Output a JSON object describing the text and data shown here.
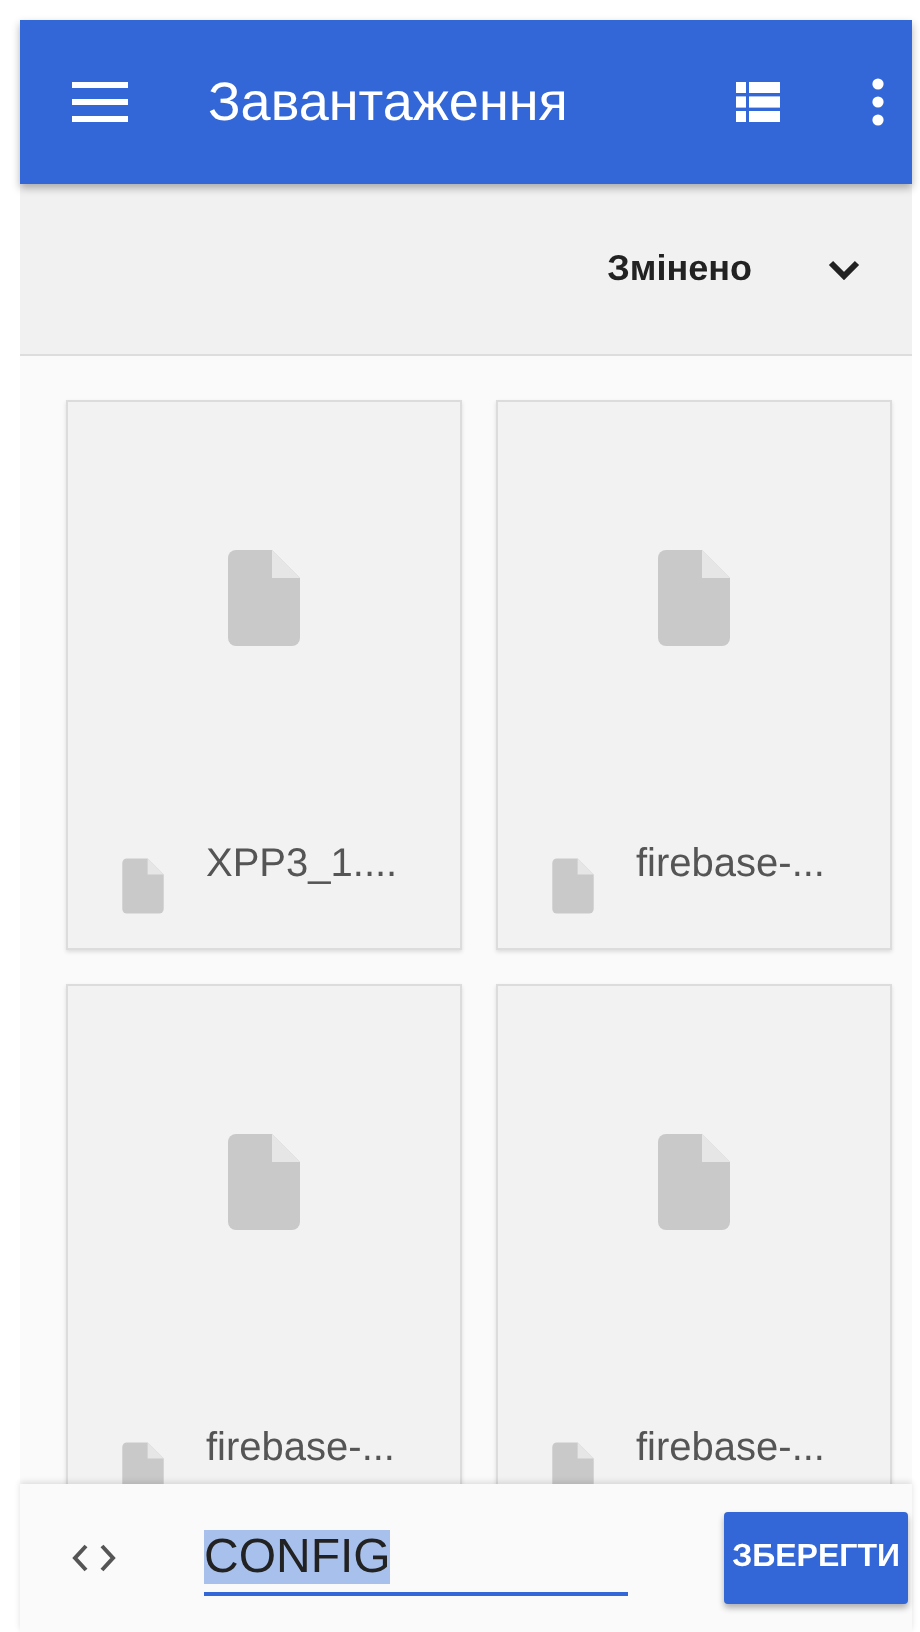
{
  "app_bar": {
    "title": "Завантаження"
  },
  "sort_bar": {
    "label": "Змінено"
  },
  "files": [
    {
      "name": "XPP3_1...."
    },
    {
      "name": "firebase-..."
    },
    {
      "name": "firebase-..."
    },
    {
      "name": "firebase-..."
    }
  ],
  "bottom_bar": {
    "field": {
      "value": "CONFIG",
      "text_selected": true
    },
    "button": "ЗБЕРЕГТИ"
  }
}
